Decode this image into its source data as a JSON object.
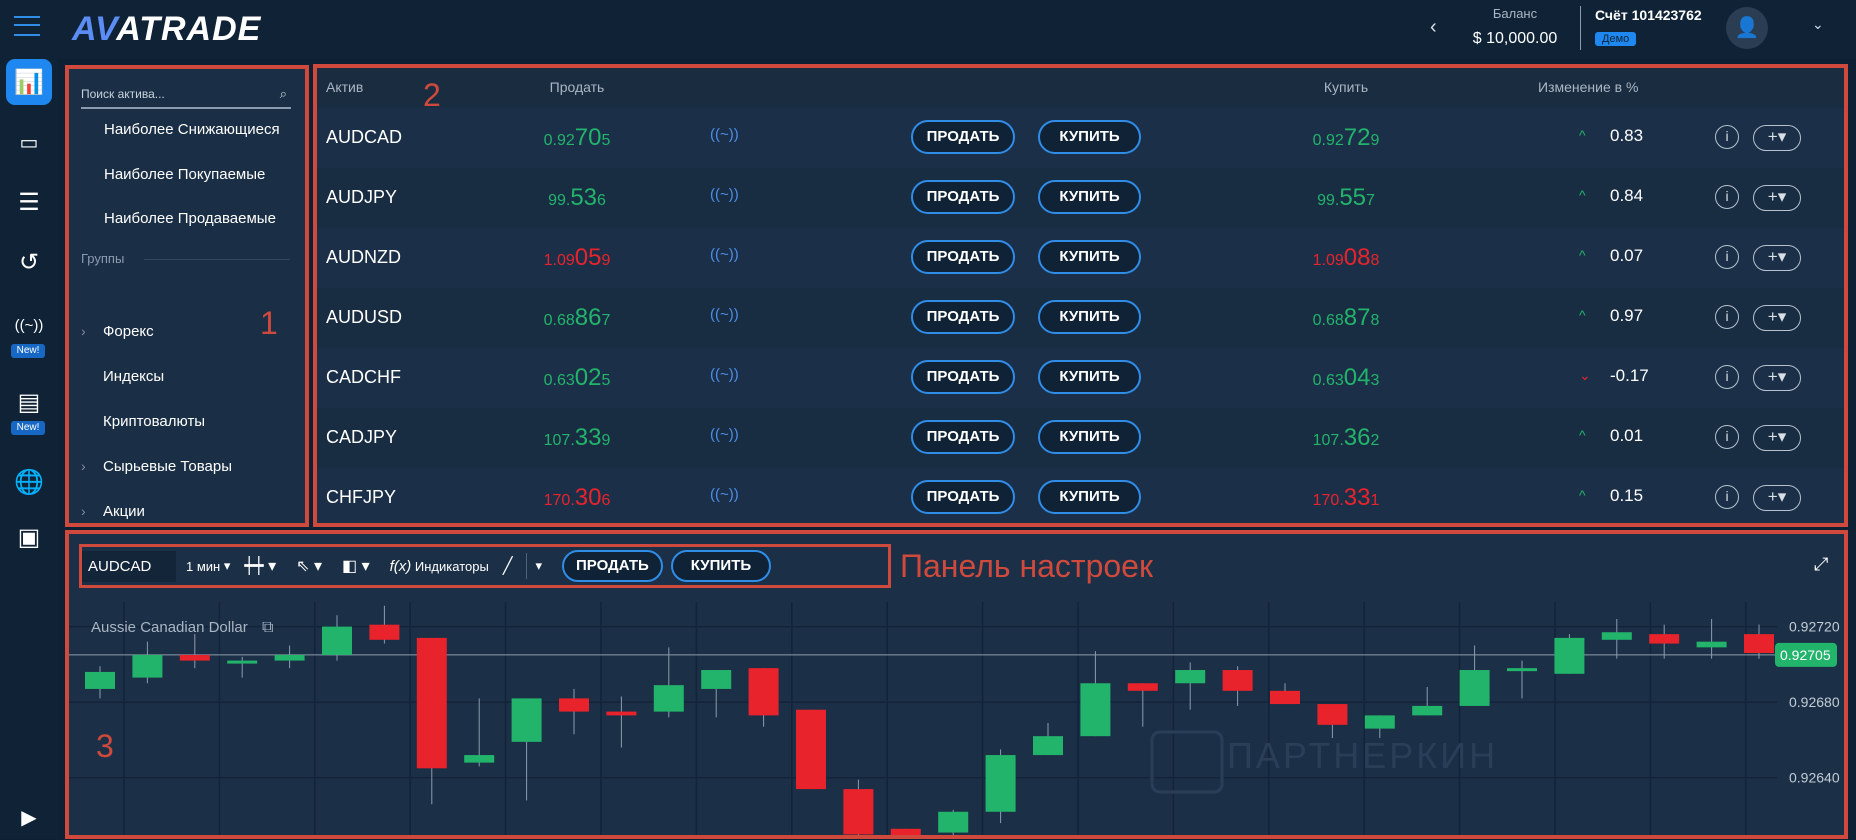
{
  "topbar": {
    "logo": "AVATRADE",
    "balance_label": "Баланс",
    "balance_value": "$ 10,000.00",
    "account_label": "Счёт 101423762",
    "account_badge": "Демо"
  },
  "rail": {
    "items": [
      {
        "icon": "menu-icon"
      },
      {
        "icon": "chart-icon",
        "active": true
      },
      {
        "icon": "briefcase-icon"
      },
      {
        "icon": "list-icon"
      },
      {
        "icon": "history-icon"
      },
      {
        "icon": "signal-icon",
        "badge": "New!"
      },
      {
        "icon": "news-icon",
        "badge": "New!"
      },
      {
        "icon": "globe-icon"
      },
      {
        "icon": "window-icon"
      },
      {
        "icon": "video-icon"
      }
    ]
  },
  "assets_panel": {
    "search_placeholder": "Поиск актива...",
    "quick_lists": [
      "Наиболее Снижающиеся",
      "Наиболее Покупаемые",
      "Наиболее Продаваемые"
    ],
    "groups_label": "Группы",
    "groups": [
      {
        "label": "Форекс",
        "expandable": true
      },
      {
        "label": "Индексы",
        "expandable": false
      },
      {
        "label": "Криптовалюты",
        "expandable": false
      },
      {
        "label": "Сырьевые Товары",
        "expandable": true
      },
      {
        "label": "Акции",
        "expandable": true
      }
    ]
  },
  "table": {
    "headers": {
      "asset": "Актив",
      "sell": "Продать",
      "buy": "Купить",
      "change": "Изменение в %"
    },
    "sell_button": "ПРОДАТЬ",
    "buy_button": "КУПИТЬ",
    "rows": [
      {
        "symbol": "AUDCAD",
        "sell": [
          "0.92",
          "70",
          "5"
        ],
        "buy": [
          "0.92",
          "72",
          "9"
        ],
        "price_dir": "up",
        "change_dir": "up",
        "change": "0.83"
      },
      {
        "symbol": "AUDJPY",
        "sell": [
          "99.",
          "53",
          "6"
        ],
        "buy": [
          "99.",
          "55",
          "7"
        ],
        "price_dir": "up",
        "change_dir": "up",
        "change": "0.84"
      },
      {
        "symbol": "AUDNZD",
        "sell": [
          "1.09",
          "05",
          "9"
        ],
        "buy": [
          "1.09",
          "08",
          "8"
        ],
        "price_dir": "down",
        "change_dir": "up",
        "change": "0.07"
      },
      {
        "symbol": "AUDUSD",
        "sell": [
          "0.68",
          "86",
          "7"
        ],
        "buy": [
          "0.68",
          "87",
          "8"
        ],
        "price_dir": "up",
        "change_dir": "up",
        "change": "0.97"
      },
      {
        "symbol": "CADCHF",
        "sell": [
          "0.63",
          "02",
          "5"
        ],
        "buy": [
          "0.63",
          "04",
          "3"
        ],
        "price_dir": "up",
        "change_dir": "down",
        "change": "-0.17"
      },
      {
        "symbol": "CADJPY",
        "sell": [
          "107.",
          "33",
          "9"
        ],
        "buy": [
          "107.",
          "36",
          "2"
        ],
        "price_dir": "up",
        "change_dir": "up",
        "change": "0.01"
      },
      {
        "symbol": "CHFJPY",
        "sell": [
          "170.",
          "30",
          "6"
        ],
        "buy": [
          "170.",
          "33",
          "1"
        ],
        "price_dir": "down",
        "change_dir": "up",
        "change": "0.15"
      }
    ]
  },
  "chart_toolbar": {
    "symbol": "AUDCAD",
    "timeframe": "1 мин",
    "indicators": "Индикаторы",
    "sell": "ПРОДАТЬ",
    "buy": "КУПИТЬ"
  },
  "annotations": {
    "box1": "1",
    "box2": "2",
    "box3": "3",
    "toolbar_label": "Панель настроек"
  },
  "watermark": "ПАРТНЕРКИН",
  "colors": {
    "up": "#22b46b",
    "down": "#e8232c",
    "accent": "#1e88f0",
    "annotation": "#cf4a3c"
  },
  "chart_data": {
    "type": "candlestick",
    "title": "Aussie Canadian Dollar",
    "ylim": [
      0.92606,
      0.92733
    ],
    "yticks": [
      "0.92720",
      "0.92680",
      "0.92640"
    ],
    "current_price": "0.92705",
    "grid": true,
    "candles": [
      [
        0.92687,
        0.92699,
        0.92682,
        0.92696
      ],
      [
        0.92693,
        0.92712,
        0.9269,
        0.92705
      ],
      [
        0.92705,
        0.92716,
        0.92698,
        0.92702
      ],
      [
        0.92701,
        0.92704,
        0.92693,
        0.92702
      ],
      [
        0.92702,
        0.9271,
        0.92698,
        0.92705
      ],
      [
        0.92705,
        0.92726,
        0.92702,
        0.9272
      ],
      [
        0.92721,
        0.92731,
        0.92711,
        0.92713
      ],
      [
        0.92714,
        0.92714,
        0.92626,
        0.92645
      ],
      [
        0.92648,
        0.92682,
        0.92646,
        0.92652
      ],
      [
        0.92659,
        0.92682,
        0.92628,
        0.92682
      ],
      [
        0.92682,
        0.92687,
        0.92663,
        0.92675
      ],
      [
        0.92675,
        0.92683,
        0.92656,
        0.92673
      ],
      [
        0.92675,
        0.92709,
        0.92672,
        0.92689
      ],
      [
        0.92687,
        0.92697,
        0.92672,
        0.92697
      ],
      [
        0.92698,
        0.92698,
        0.92667,
        0.92673
      ],
      [
        0.92676,
        0.92676,
        0.92634,
        0.92634
      ],
      [
        0.92634,
        0.92639,
        0.92604,
        0.9261
      ],
      [
        0.92613,
        0.92613,
        0.92604,
        0.92607
      ],
      [
        0.92611,
        0.92623,
        0.92604,
        0.92622
      ],
      [
        0.92622,
        0.92655,
        0.92616,
        0.92652
      ],
      [
        0.92652,
        0.92669,
        0.92652,
        0.92662
      ],
      [
        0.92662,
        0.92707,
        0.92662,
        0.9269
      ],
      [
        0.9269,
        0.9269,
        0.92667,
        0.92686
      ],
      [
        0.9269,
        0.92701,
        0.92676,
        0.92697
      ],
      [
        0.92697,
        0.92699,
        0.92678,
        0.92686
      ],
      [
        0.92686,
        0.9269,
        0.92679,
        0.92679
      ],
      [
        0.92679,
        0.92679,
        0.92661,
        0.92668
      ],
      [
        0.92666,
        0.92673,
        0.92661,
        0.92673
      ],
      [
        0.92673,
        0.92688,
        0.92673,
        0.92678
      ],
      [
        0.92678,
        0.9271,
        0.92678,
        0.92697
      ],
      [
        0.92697,
        0.92702,
        0.92682,
        0.92698
      ],
      [
        0.92695,
        0.92716,
        0.92695,
        0.92714
      ],
      [
        0.92713,
        0.92724,
        0.92703,
        0.92717
      ],
      [
        0.92716,
        0.92721,
        0.92703,
        0.92711
      ],
      [
        0.92709,
        0.92724,
        0.92703,
        0.92712
      ],
      [
        0.92716,
        0.92721,
        0.92703,
        0.92706
      ]
    ]
  }
}
